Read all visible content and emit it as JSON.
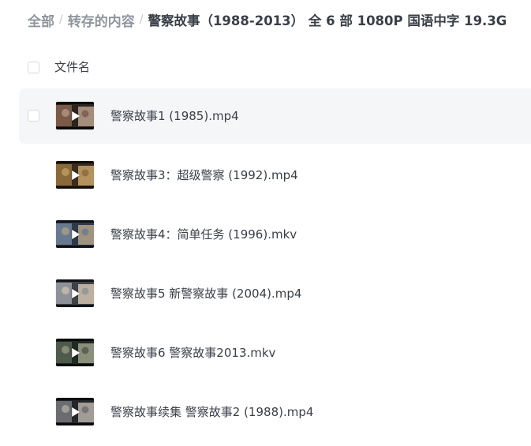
{
  "breadcrumb": {
    "items": [
      "全部",
      "转存的内容"
    ],
    "separator": "/",
    "current": "警察故事（1988-2013） 全 6 部 1080P 国语中字 19.3G"
  },
  "list": {
    "header_label": "文件名",
    "files": [
      {
        "name": "警察故事1  (1985).mp4",
        "thumb_colors": [
          "#2b2420",
          "#7a5a48",
          "#b9a08c"
        ],
        "hovered": true
      },
      {
        "name": "警察故事3：超级警察 (1992).mp4",
        "thumb_colors": [
          "#3a2c1e",
          "#8a6a3a",
          "#c9a46a"
        ],
        "hovered": false
      },
      {
        "name": "警察故事4：简单任务 (1996).mkv",
        "thumb_colors": [
          "#2e3a4a",
          "#6a7a8e",
          "#b4a48a"
        ],
        "hovered": false
      },
      {
        "name": "警察故事5 新警察故事 (2004).mp4",
        "thumb_colors": [
          "#3e4248",
          "#8e9298",
          "#d2c4b0"
        ],
        "hovered": false
      },
      {
        "name": "警察故事6 警察故事2013.mkv",
        "thumb_colors": [
          "#1e2a22",
          "#4e5a4a",
          "#9ea08a"
        ],
        "hovered": false
      },
      {
        "name": "警察故事续集 警察故事2  (1988).mp4",
        "thumb_colors": [
          "#24262a",
          "#6a6c70",
          "#b8b2aa"
        ],
        "hovered": false
      }
    ]
  },
  "colors": {
    "hover_row": "#f5f6f8",
    "text_primary": "#3a3f47",
    "text_secondary": "#8f949c"
  },
  "icons": {
    "play": "play-icon",
    "checkbox": "checkbox-icon"
  }
}
